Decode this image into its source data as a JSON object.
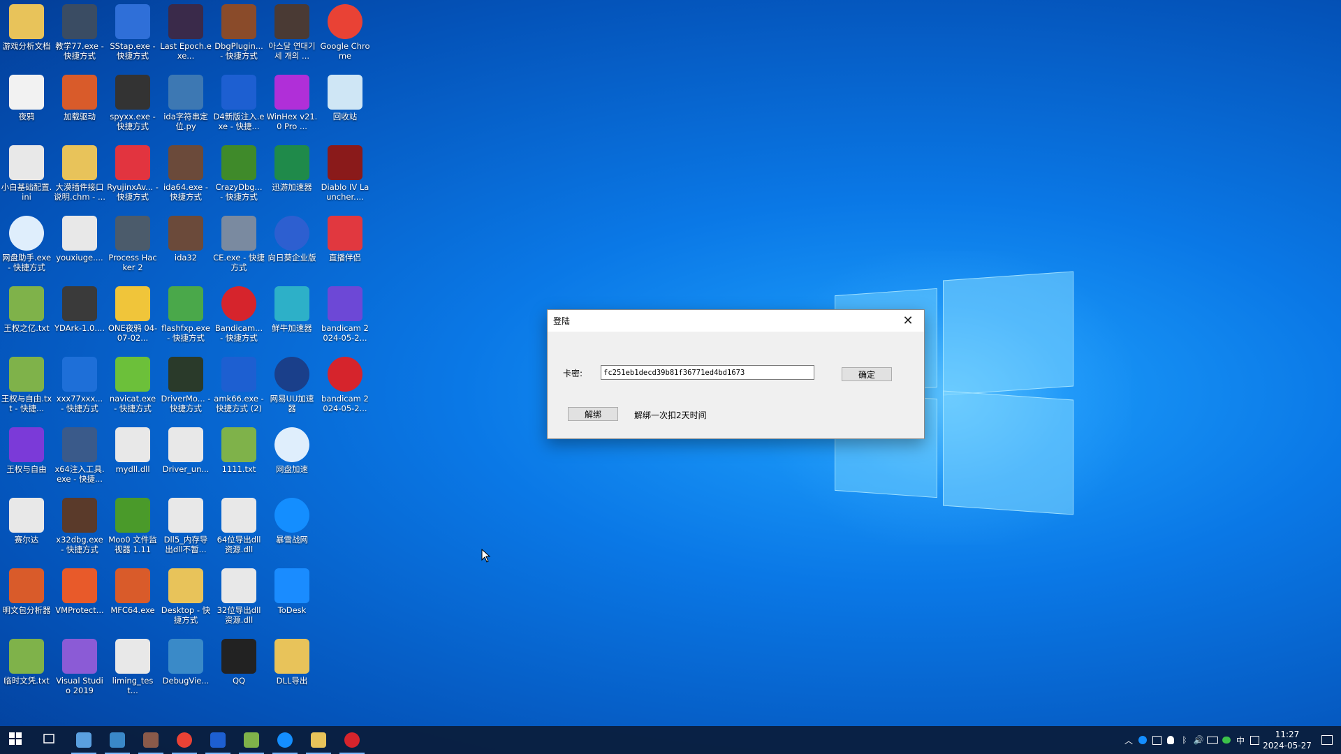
{
  "desktop": {
    "icons": [
      {
        "label": "游戏分析文档",
        "icon": "folder-icon",
        "color": "#e8c35a"
      },
      {
        "label": "教学77.exe - 快捷方式",
        "icon": "bug-icon",
        "color": "#3a4c63"
      },
      {
        "label": "SStap.exe - 快捷方式",
        "icon": "shield-icon",
        "color": "#2f6fd8"
      },
      {
        "label": "Last Epoch.exe...",
        "icon": "game-icon",
        "color": "#3a2a4a"
      },
      {
        "label": "DbgPlugin... - 快捷方式",
        "icon": "bug-icon",
        "color": "#8a4b2a"
      },
      {
        "label": "아스달 연대기 세 개의 ...",
        "icon": "game-icon",
        "color": "#4a3a34"
      },
      {
        "label": "Google Chrome",
        "icon": "chrome-icon",
        "color": "#e94235"
      },
      {
        "label": "夜鸦",
        "icon": "night-crows-icon",
        "color": "#f2f2f2"
      },
      {
        "label": "加载驱动",
        "icon": "app-icon",
        "color": "#d95b2a"
      },
      {
        "label": "spyxx.exe - 快捷方式",
        "icon": "spy-icon",
        "color": "#333333"
      },
      {
        "label": "ida字符串定位.py",
        "icon": "python-icon",
        "color": "#3d78b3"
      },
      {
        "label": "D4新版注入.exe - 快捷...",
        "icon": "check-icon",
        "color": "#1d5fd1"
      },
      {
        "label": "WinHex v21.0 Pro ...",
        "icon": "hex-icon",
        "color": "#b02fd8"
      },
      {
        "label": "回收站",
        "icon": "recycle-bin-icon",
        "color": "#cfe6f5"
      },
      {
        "label": "小白基础配置.ini",
        "icon": "settings-file-icon",
        "color": "#e8e8e8"
      },
      {
        "label": "大漠插件接口说明.chm - ...",
        "icon": "help-icon",
        "color": "#e8c35a"
      },
      {
        "label": "RyujinxAv... - 快捷方式",
        "icon": "switch-icon",
        "color": "#e2343f"
      },
      {
        "label": "ida64.exe - 快捷方式",
        "icon": "ida-icon",
        "color": "#6b4a3a"
      },
      {
        "label": "CrazyDbg... - 快捷方式",
        "icon": "bug-icon",
        "color": "#3f8a2a"
      },
      {
        "label": "迅游加速器",
        "icon": "xunyou-icon",
        "color": "#1f8a4a"
      },
      {
        "label": "Diablo IV Launcher....",
        "icon": "diablo-icon",
        "color": "#8a1a1a"
      },
      {
        "label": "网盘助手.exe - 快捷方式",
        "icon": "cloud-icon",
        "color": "#dfeefc"
      },
      {
        "label": "youxiuge....",
        "icon": "file-icon",
        "color": "#e8e8e8"
      },
      {
        "label": "Process Hacker 2",
        "icon": "monitor-icon",
        "color": "#4b5b6b"
      },
      {
        "label": "ida32",
        "icon": "ida-icon",
        "color": "#6b4a3a"
      },
      {
        "label": "CE.exe - 快捷方式",
        "icon": "cheat-engine-icon",
        "color": "#7a8aa0"
      },
      {
        "label": "向日葵企业版",
        "icon": "sunlogin-icon",
        "color": "#2d5fd0"
      },
      {
        "label": "直播伴侣",
        "icon": "live-icon",
        "color": "#e1383f"
      },
      {
        "label": "王权之亿.txt",
        "icon": "text-file-icon",
        "color": "#7fb24a"
      },
      {
        "label": "YDArk-1.0....",
        "icon": "gear-icon",
        "color": "#3a3a3a"
      },
      {
        "label": "ONE夜鸦 04-07-02...",
        "icon": "book-icon",
        "color": "#f0c53a"
      },
      {
        "label": "flashfxp.exe - 快捷方式",
        "icon": "ftp-icon",
        "color": "#4aa84a"
      },
      {
        "label": "Bandicam... - 快捷方式",
        "icon": "record-icon",
        "color": "#d6242c"
      },
      {
        "label": "鲜牛加速器",
        "icon": "cow-icon",
        "color": "#2db0c8"
      },
      {
        "label": "bandicam 2024-05-2...",
        "icon": "video-icon",
        "color": "#6d48d6"
      },
      {
        "label": "王权与自由.txt - 快捷...",
        "icon": "text-file-icon",
        "color": "#7fb24a"
      },
      {
        "label": "xxx77xxx... - 快捷方式",
        "icon": "gear-icon",
        "color": "#1e6fd8"
      },
      {
        "label": "navicat.exe - 快捷方式",
        "icon": "navicat-icon",
        "color": "#6cc03a"
      },
      {
        "label": "DriverMo... - 快捷方式",
        "icon": "terminal-icon",
        "color": "#2a3a2a"
      },
      {
        "label": "amk66.exe - 快捷方式 (2)",
        "icon": "check-icon",
        "color": "#1d5fd1"
      },
      {
        "label": "网易UU加速器",
        "icon": "uu-icon",
        "color": "#1a3f8a"
      },
      {
        "label": "bandicam 2024-05-2...",
        "icon": "record-icon",
        "color": "#d6242c"
      },
      {
        "label": "王权与自由",
        "icon": "game-icon",
        "color": "#7b3ad8"
      },
      {
        "label": "x64注入工具.exe - 快捷...",
        "icon": "syringe-icon",
        "color": "#3a5a8a"
      },
      {
        "label": "mydll.dll",
        "icon": "dll-file-icon",
        "color": "#e8e8e8"
      },
      {
        "label": "Driver_un...",
        "icon": "dll-file-icon",
        "color": "#e8e8e8"
      },
      {
        "label": "1111.txt",
        "icon": "text-file-icon",
        "color": "#7fb24a"
      },
      {
        "label": "网盘加速",
        "icon": "cloud-icon",
        "color": "#dfeefc"
      },
      {
        "label": "",
        "icon": "",
        "color": ""
      },
      {
        "label": "赛尔达",
        "icon": "dll-file-icon",
        "color": "#e8e8e8"
      },
      {
        "label": "x32dbg.exe - 快捷方式",
        "icon": "bug-icon",
        "color": "#5a3a2a"
      },
      {
        "label": "Moo0 文件监视器 1.11",
        "icon": "moo0-icon",
        "color": "#4a9a2a"
      },
      {
        "label": "Dll5_内存导出dll不暂...",
        "icon": "dll-file-icon",
        "color": "#e8e8e8"
      },
      {
        "label": "64位导出dll资源.dll",
        "icon": "dll-file-icon",
        "color": "#e8e8e8"
      },
      {
        "label": "暴雪战网",
        "icon": "battlenet-icon",
        "color": "#148eff"
      },
      {
        "label": "",
        "icon": "",
        "color": ""
      },
      {
        "label": "明文包分析器",
        "icon": "app-icon",
        "color": "#d95b2a"
      },
      {
        "label": "VMProtect...",
        "icon": "vmprotect-icon",
        "color": "#e85a2a"
      },
      {
        "label": "MFC64.exe",
        "icon": "mfc-icon",
        "color": "#d95b2a"
      },
      {
        "label": "Desktop - 快捷方式",
        "icon": "folder-icon",
        "color": "#e8c35a"
      },
      {
        "label": "32位导出dll资源.dll",
        "icon": "dll-file-icon",
        "color": "#e8e8e8"
      },
      {
        "label": "ToDesk",
        "icon": "todesk-icon",
        "color": "#1a8cff"
      },
      {
        "label": "",
        "icon": "",
        "color": ""
      },
      {
        "label": "临时文凭.txt",
        "icon": "text-file-icon",
        "color": "#7fb24a"
      },
      {
        "label": "Visual Studio 2019",
        "icon": "visual-studio-icon",
        "color": "#8b5bd6"
      },
      {
        "label": "liming_test...",
        "icon": "dll-file-icon",
        "color": "#e8e8e8"
      },
      {
        "label": "DebugVie...",
        "icon": "debugview-icon",
        "color": "#3a8ac8"
      },
      {
        "label": "QQ",
        "icon": "qq-icon",
        "color": "#222222"
      },
      {
        "label": "DLL导出",
        "icon": "folder-icon",
        "color": "#e8c35a"
      },
      {
        "label": "",
        "icon": "",
        "color": ""
      }
    ]
  },
  "dialog": {
    "title": "登陆",
    "key_label": "卡密:",
    "key_value": "fc251eb1decd39b81f36771ed4bd1673",
    "ok_label": "确定",
    "unbind_label": "解绑",
    "note": "解绑一次扣2天时间"
  },
  "taskbar": {
    "items": [
      {
        "name": "start-button",
        "icon": "windows-icon",
        "color": "#ffffff"
      },
      {
        "name": "task-view-button",
        "icon": "task-view-icon",
        "color": "#ffffff"
      },
      {
        "name": "taskbar-app-1",
        "icon": "app-icon",
        "color": "#5aa0e0"
      },
      {
        "name": "taskbar-app-2",
        "icon": "app-icon",
        "color": "#3a88c8"
      },
      {
        "name": "taskbar-app-3",
        "icon": "ida-icon",
        "color": "#8a5a4a"
      },
      {
        "name": "taskbar-chrome",
        "icon": "chrome-icon",
        "color": "#e94235"
      },
      {
        "name": "taskbar-app-4",
        "icon": "check-icon",
        "color": "#1d5fd1"
      },
      {
        "name": "taskbar-notepad",
        "icon": "text-file-icon",
        "color": "#7fb24a"
      },
      {
        "name": "taskbar-battlenet",
        "icon": "battlenet-icon",
        "color": "#148eff"
      },
      {
        "name": "taskbar-explorer",
        "icon": "folder-icon",
        "color": "#e8c35a"
      },
      {
        "name": "taskbar-bandicam",
        "icon": "record-icon",
        "color": "#d6242c"
      }
    ],
    "tray": {
      "ime": "中",
      "time": "11:27",
      "date": "2024-05-27"
    }
  }
}
